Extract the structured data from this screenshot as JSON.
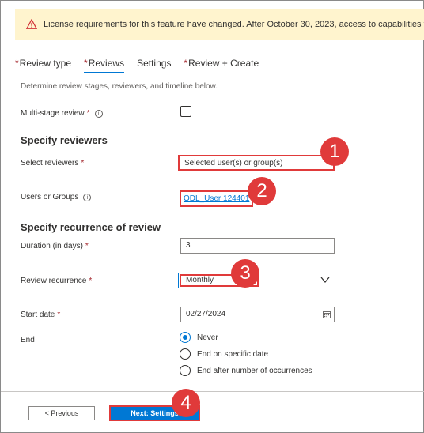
{
  "banner": {
    "icon": "warning-icon",
    "message": "License requirements for this feature have changed. After October 30, 2023, access to capabilities formerly in previ"
  },
  "tabs": [
    {
      "label": "Review type",
      "required": "*"
    },
    {
      "label": "Reviews",
      "required": "*"
    },
    {
      "label": "Settings",
      "required": ""
    },
    {
      "label": "Review + Create",
      "required": "*"
    }
  ],
  "description": "Determine review stages, reviewers, and timeline below.",
  "multistage": {
    "label": "Multi-stage review",
    "required": "*",
    "info": "i"
  },
  "reviewers_section": {
    "title": "Specify reviewers"
  },
  "select_reviewers": {
    "label": "Select reviewers",
    "required": "*",
    "value": "Selected user(s) or group(s)"
  },
  "users_groups": {
    "label": "Users or Groups",
    "info": "i",
    "value": "ODL_User 124401"
  },
  "recurrence_section": {
    "title": "Specify recurrence of review"
  },
  "duration": {
    "label": "Duration (in days)",
    "required": "*",
    "value": "3"
  },
  "recurrence": {
    "label": "Review recurrence",
    "required": "*",
    "value": "Monthly"
  },
  "start_date": {
    "label": "Start date",
    "required": "*",
    "value": "02/27/2024"
  },
  "end": {
    "label": "End",
    "options": [
      {
        "label": "Never",
        "selected": true
      },
      {
        "label": "End on specific date",
        "selected": false
      },
      {
        "label": "End after number of occurrences",
        "selected": false
      }
    ]
  },
  "footer": {
    "previous_label": "< Previous",
    "next_label": "Next: Settings"
  },
  "callouts": [
    "1",
    "2",
    "3",
    "4"
  ],
  "colors": {
    "accent": "#0078d4",
    "highlight": "#e03a3a",
    "banner_bg": "#fff4ce",
    "required": "#a4262c"
  }
}
